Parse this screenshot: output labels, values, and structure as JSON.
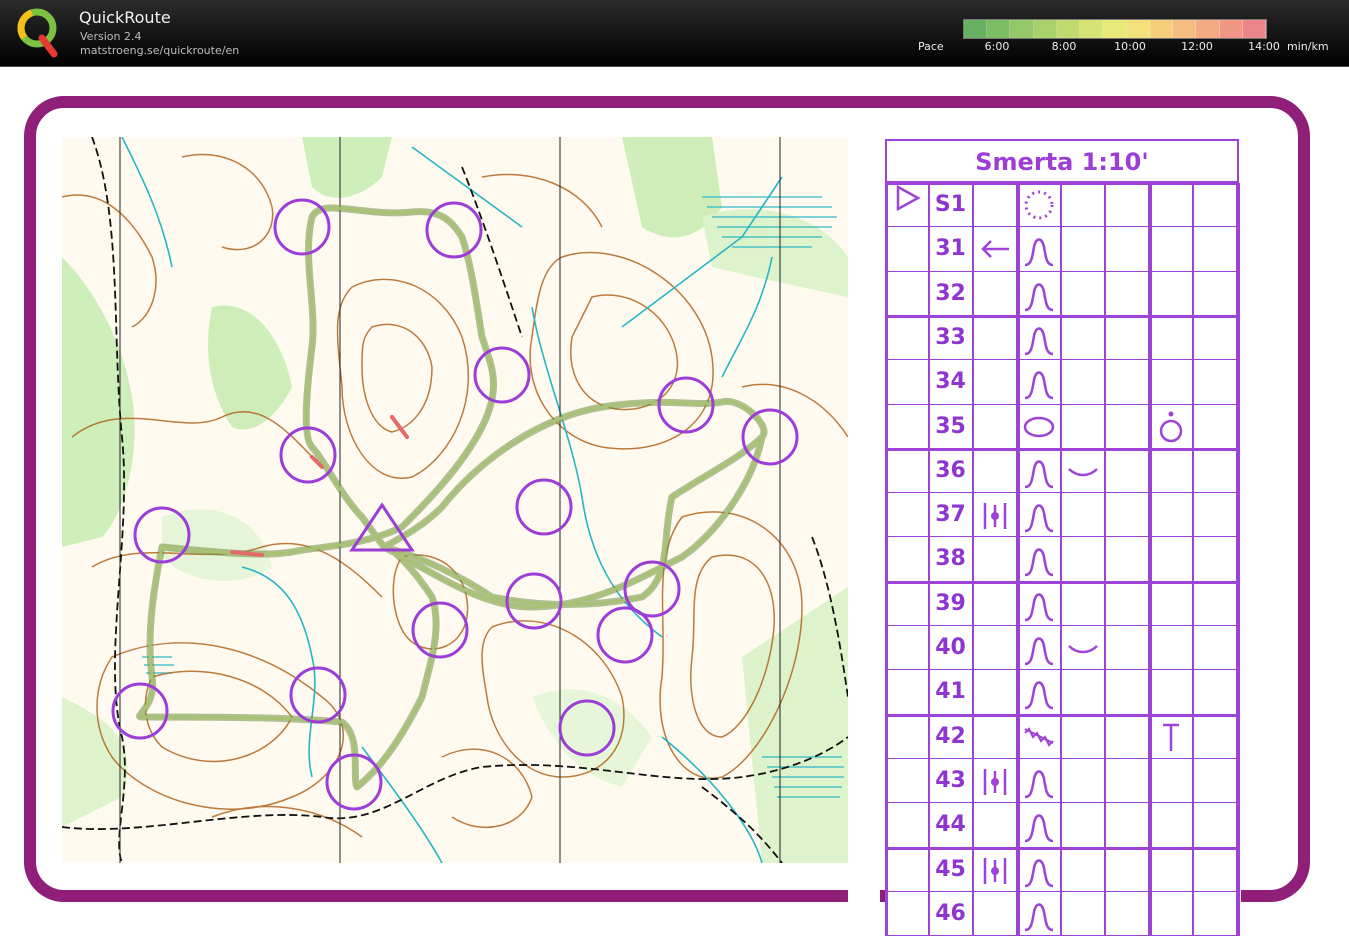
{
  "header": {
    "app_title": "QuickRoute",
    "version": "Version 2.4",
    "url": "matstroeng.se/quickroute/en",
    "pace_label": "Pace",
    "pace_ticks": [
      "6:00",
      "8:00",
      "10:00",
      "12:00",
      "14:00"
    ],
    "pace_unit": "min/km",
    "pace_colors": [
      "#66b262",
      "#7cbd64",
      "#93c767",
      "#a9d16b",
      "#c0da6f",
      "#d6e473",
      "#e8e977",
      "#f2e07a",
      "#f6cf7d",
      "#f6bd80",
      "#f4aa83",
      "#f09786",
      "#ec8589"
    ]
  },
  "colors": {
    "frame": "#8f1f78",
    "control_circle": "#9b3dd6",
    "route": "#7fa25a",
    "card": "#9d43d7"
  },
  "control_card": {
    "title": "Smerta 1:10'",
    "rows": [
      {
        "code": "S1",
        "col_c": "",
        "col_d": "dotted-circle-icon",
        "col_e": "",
        "col_g": ""
      },
      {
        "code": "31",
        "col_c": "arrow-left-icon",
        "col_d": "knoll-icon",
        "col_e": "",
        "col_g": ""
      },
      {
        "code": "32",
        "col_c": "",
        "col_d": "knoll-icon",
        "col_e": "",
        "col_g": ""
      },
      {
        "code": "33",
        "col_c": "",
        "col_d": "knoll-icon",
        "col_e": "",
        "col_g": ""
      },
      {
        "code": "34",
        "col_c": "",
        "col_d": "knoll-icon",
        "col_e": "",
        "col_g": ""
      },
      {
        "code": "35",
        "col_c": "",
        "col_d": "elongated-knoll-icon",
        "col_e": "",
        "col_g": "foot-side-icon"
      },
      {
        "code": "36",
        "col_c": "",
        "col_d": "knoll-icon",
        "col_e": "saddle-icon",
        "col_g": ""
      },
      {
        "code": "37",
        "col_c": "between-icon",
        "col_d": "knoll-icon",
        "col_e": "",
        "col_g": ""
      },
      {
        "code": "38",
        "col_c": "",
        "col_d": "knoll-icon",
        "col_e": "",
        "col_g": ""
      },
      {
        "code": "39",
        "col_c": "",
        "col_d": "knoll-icon",
        "col_e": "",
        "col_g": ""
      },
      {
        "code": "40",
        "col_c": "",
        "col_d": "knoll-icon",
        "col_e": "saddle-icon",
        "col_g": ""
      },
      {
        "code": "41",
        "col_c": "",
        "col_d": "knoll-icon",
        "col_e": "",
        "col_g": ""
      },
      {
        "code": "42",
        "col_c": "",
        "col_d": "marsh-icon",
        "col_e": "",
        "col_g": "foot-icon"
      },
      {
        "code": "43",
        "col_c": "between-icon",
        "col_d": "knoll-icon",
        "col_e": "",
        "col_g": ""
      },
      {
        "code": "44",
        "col_c": "",
        "col_d": "knoll-icon",
        "col_e": "",
        "col_g": ""
      },
      {
        "code": "45",
        "col_c": "between-icon",
        "col_d": "knoll-icon",
        "col_e": "",
        "col_g": ""
      },
      {
        "code": "46",
        "col_c": "",
        "col_d": "knoll-icon",
        "col_e": "",
        "col_g": ""
      }
    ]
  },
  "map": {
    "start_icon": "start-triangle-icon",
    "control_count": 16
  }
}
